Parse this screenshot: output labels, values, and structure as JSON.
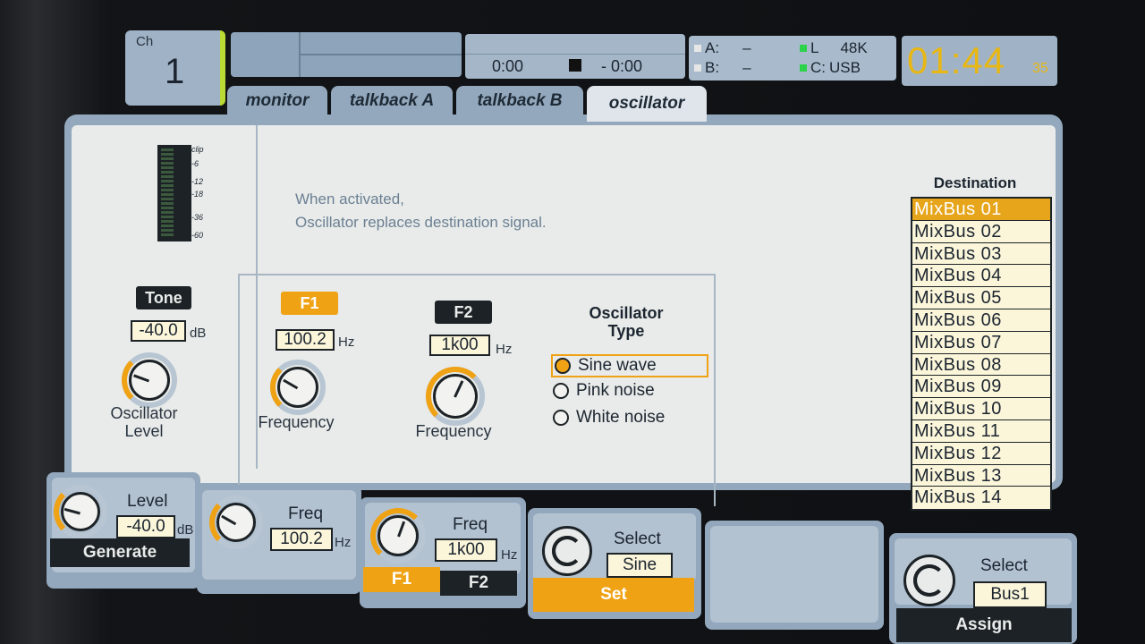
{
  "channel": {
    "label": "Ch",
    "number": "1"
  },
  "transport": {
    "elapsed": "0:00",
    "remaining": "- 0:00"
  },
  "io": {
    "a_label": "A:",
    "a_value": "–",
    "b_label": "B:",
    "b_value": "–",
    "l_label": "L",
    "l_value": "48K",
    "c_label": "C:",
    "c_value": "USB"
  },
  "clock": {
    "main": "01:44",
    "seconds": "35"
  },
  "tabs": [
    {
      "label": "monitor"
    },
    {
      "label": "talkback A"
    },
    {
      "label": "talkback B"
    },
    {
      "label": "oscillator"
    }
  ],
  "meter": {
    "scale": [
      "clip",
      "-6",
      "-12",
      "-18",
      "-36",
      "-60"
    ]
  },
  "tone": {
    "badge": "Tone",
    "value": "-40.0",
    "unit": "dB",
    "caption_line1": "Oscillator",
    "caption_line2": "Level"
  },
  "info": {
    "line1": "When activated,",
    "line2": "Oscillator replaces destination signal."
  },
  "f1": {
    "badge": "F1",
    "value": "100.2",
    "unit": "Hz",
    "caption": "Frequency"
  },
  "f2": {
    "badge": "F2",
    "value": "1k00",
    "unit": "Hz",
    "caption": "Frequency"
  },
  "osc_type": {
    "title_line1": "Oscillator",
    "title_line2": "Type",
    "options": [
      "Sine wave",
      "Pink noise",
      "White noise"
    ],
    "selected": "Sine wave"
  },
  "destination": {
    "title": "Destination",
    "items": [
      "MixBus 01",
      "MixBus 02",
      "MixBus 03",
      "MixBus 04",
      "MixBus 05",
      "MixBus 06",
      "MixBus 07",
      "MixBus 08",
      "MixBus 09",
      "MixBus 10",
      "MixBus 11",
      "MixBus 12",
      "MixBus 13",
      "MixBus 14"
    ],
    "selected": "MixBus 01"
  },
  "encoders": {
    "level": {
      "label": "Level",
      "value": "-40.0",
      "unit": "dB",
      "button": "Generate"
    },
    "freq1": {
      "label": "Freq",
      "value": "100.2",
      "unit": "Hz"
    },
    "freq2": {
      "label": "Freq",
      "value": "1k00",
      "unit": "Hz",
      "btn_f1": "F1",
      "btn_f2": "F2"
    },
    "select_type": {
      "label": "Select",
      "value": "Sine",
      "button": "Set"
    },
    "assign": {
      "label": "Select",
      "value": "Bus1",
      "button": "Assign"
    }
  },
  "colors": {
    "accent": "#f0a215",
    "panel": "#93a8bd",
    "background": "#e8ebe9",
    "clock": "#e8b714",
    "channel_edge": "#b9d934"
  }
}
